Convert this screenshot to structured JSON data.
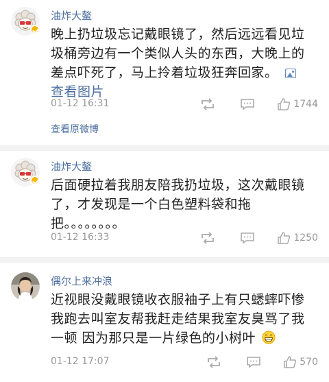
{
  "comments": [
    {
      "user": "油炸大鳌",
      "verified": true,
      "lines": [
        "晚上扔垃圾忘记戴眼镜了，然后远远看见垃",
        "圾桶旁边有一个类似人头的东西，大晚上的",
        "差点吓死了，马上拎着垃圾狂奔回家。"
      ],
      "view_pic_label": "查看图片",
      "time": "01-12 16:31",
      "likes": "1744",
      "view_original_label": "查看原微博"
    },
    {
      "user": "油炸大鳌",
      "verified": true,
      "lines": [
        "后面硬拉着我朋友陪我扔垃圾，这次戴眼镜",
        "了，才发现是一个白色塑料袋和拖",
        "把。。。。。。。。"
      ],
      "time": "01-12 16:33",
      "likes": "1250"
    },
    {
      "user": "偶尔上来冲浪",
      "verified": false,
      "lines": [
        "近视眼没戴眼镜收衣服袖子上有只蟋蟀吓惨",
        "我跑去叫室友帮我赶走结果我室友臭骂了我",
        "一顿 因为那只是一片绿色的小树叶"
      ],
      "emoji": "grin-emoji",
      "time": "01-12 17:07",
      "likes": "570"
    }
  ],
  "icons": {
    "repost": "repost-icon",
    "comment": "comment-icon",
    "like": "thumbs-up-icon",
    "picture": "picture-icon"
  },
  "colors": {
    "link": "#4d6fa0",
    "verified_badge": "#f6b700"
  }
}
